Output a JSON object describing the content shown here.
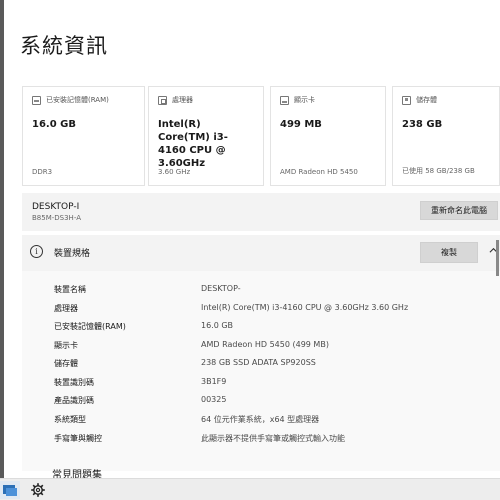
{
  "page": {
    "title": "系統資訊"
  },
  "cards": [
    {
      "icon": "memory-icon",
      "label": "已安裝記憶體(RAM)",
      "value": "16.0 GB",
      "sub": "DDR3"
    },
    {
      "icon": "processor-icon",
      "label": "處理器",
      "value": "Intel(R) Core(TM) i3-4160 CPU @ 3.60GHz",
      "sub": "3.60 GHz"
    },
    {
      "icon": "display-icon",
      "label": "顯示卡",
      "value": "499 MB",
      "sub": "AMD Radeon HD 5450"
    },
    {
      "icon": "storage-icon",
      "label": "儲存體",
      "value": "238 GB",
      "sub": "已使用 58 GB/238 GB"
    }
  ],
  "device": {
    "name": "DESKTOP-I",
    "model": "B85M-DS3H-A",
    "rename_label": "重新命名此電腦"
  },
  "specs": {
    "title": "裝置規格",
    "copy_label": "複製",
    "rows": [
      {
        "label": "裝置名稱",
        "value": "DESKTOP-"
      },
      {
        "label": "處理器",
        "value": "Intel(R) Core(TM) i3-4160 CPU @ 3.60GHz   3.60 GHz"
      },
      {
        "label": "已安裝記憶體(RAM)",
        "value": "16.0 GB"
      },
      {
        "label": "顯示卡",
        "value": "AMD Radeon HD 5450 (499 MB)"
      },
      {
        "label": "儲存體",
        "value": "238 GB SSD ADATA SP920SS"
      },
      {
        "label": "裝置識別碼",
        "value": "3B1F9"
      },
      {
        "label": "產品識別碼",
        "value": "00325"
      },
      {
        "label": "系統類型",
        "value": "64 位元作業系統，x64 型處理器"
      },
      {
        "label": "手寫筆與觸控",
        "value": "此顯示器不提供手寫筆或觸控式輸入功能"
      }
    ]
  },
  "related": {
    "title": "常見問題集"
  },
  "taskbar": {
    "settings_icon": "gear-icon"
  }
}
